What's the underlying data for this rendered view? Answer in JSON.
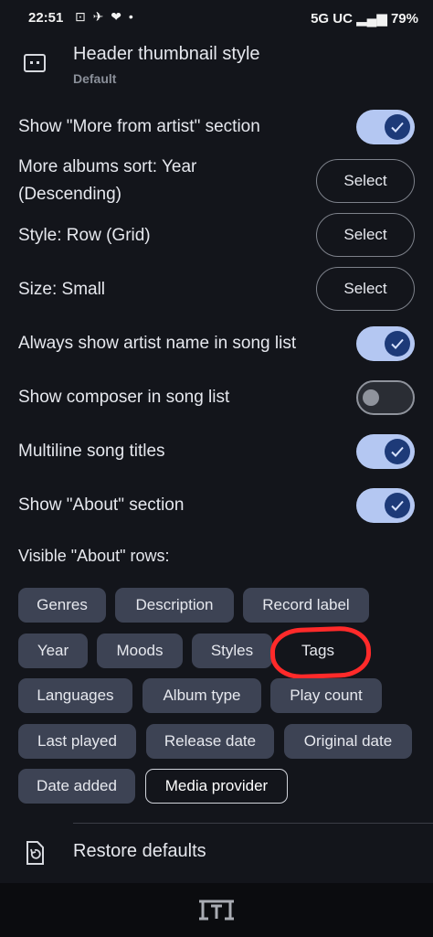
{
  "status_bar": {
    "time": "22:51",
    "icons": "⊡ ✈ ❤ •",
    "network": "5G UC",
    "battery": "79%"
  },
  "header": {
    "title": "Header thumbnail style",
    "subtitle": "Default",
    "icon": "screen-dots-icon"
  },
  "settings": {
    "more_from_artist": {
      "label": "Show \"More from artist\" section",
      "enabled": true
    },
    "albums_sort": {
      "label_line1": "More albums sort: Year",
      "label_line2": "(Descending)",
      "button": "Select"
    },
    "style": {
      "label": "Style: Row (Grid)",
      "button": "Select"
    },
    "size": {
      "label": "Size: Small",
      "button": "Select"
    },
    "artist_name": {
      "label": "Always show artist name in song list",
      "enabled": true
    },
    "composer": {
      "label": "Show composer in song list",
      "enabled": false
    },
    "multiline": {
      "label": "Multiline song titles",
      "enabled": true
    },
    "about_section": {
      "label": "Show \"About\" section",
      "enabled": true
    }
  },
  "about_rows": {
    "heading": "Visible \"About\" rows:",
    "chips": [
      {
        "label": "Genres",
        "selected": true
      },
      {
        "label": "Description",
        "selected": true
      },
      {
        "label": "Record label",
        "selected": true
      },
      {
        "label": "Year",
        "selected": true
      },
      {
        "label": "Moods",
        "selected": true
      },
      {
        "label": "Styles",
        "selected": true
      },
      {
        "label": "Tags",
        "selected": false
      },
      {
        "label": "Languages",
        "selected": true
      },
      {
        "label": "Album type",
        "selected": true
      },
      {
        "label": "Play count",
        "selected": true
      },
      {
        "label": "Last played",
        "selected": true
      },
      {
        "label": "Release date",
        "selected": true
      },
      {
        "label": "Original date",
        "selected": true
      },
      {
        "label": "Date added",
        "selected": true
      },
      {
        "label": "Media provider",
        "selected": false
      }
    ]
  },
  "footer": {
    "restore_label": "Restore defaults"
  },
  "colors": {
    "background": "#13151b",
    "toggle_on": "#b4c7f2",
    "knob_on": "#1d3a78",
    "chip": "#3d4354",
    "annotation": "#ff2a2a"
  }
}
